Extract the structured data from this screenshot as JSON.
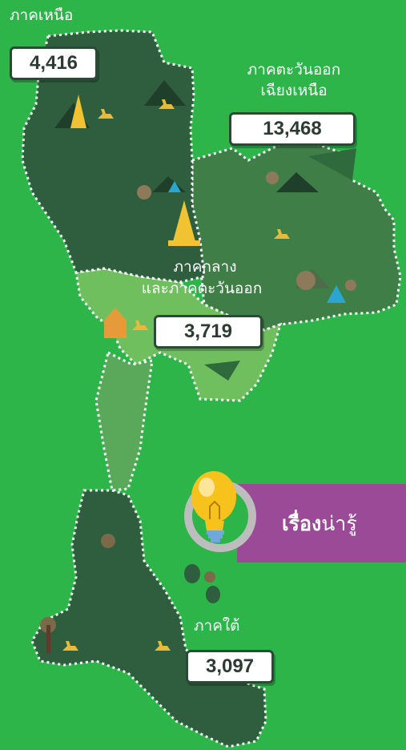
{
  "regions": {
    "north": {
      "label": "ภาคเหนือ",
      "value": "4,416"
    },
    "northeast": {
      "label_line1": "ภาคตะวันออก",
      "label_line2": "เฉียงเหนือ",
      "value": "13,468"
    },
    "central": {
      "label_line1": "ภาคกลาง",
      "label_line2": "และภาคตะวันออก",
      "value": "3,719"
    },
    "south": {
      "label": "ภาคใต้",
      "value": "3,097"
    }
  },
  "banner": {
    "bold_text": "เรื่อง",
    "text": "น่ารู้"
  },
  "colors": {
    "background": "#2db54a",
    "north_region": "#2e5e3e",
    "northeast_region": "#3f7f47",
    "central_region": "#6fbf5f",
    "south_region": "#2e5e3e",
    "banner": "#9a4a96",
    "bulb": "#f7c21b"
  },
  "icons": [
    "airplane-icon",
    "temple-icon",
    "tree-icon",
    "waterfall-icon",
    "palm-tree-icon",
    "lightbulb-icon"
  ]
}
